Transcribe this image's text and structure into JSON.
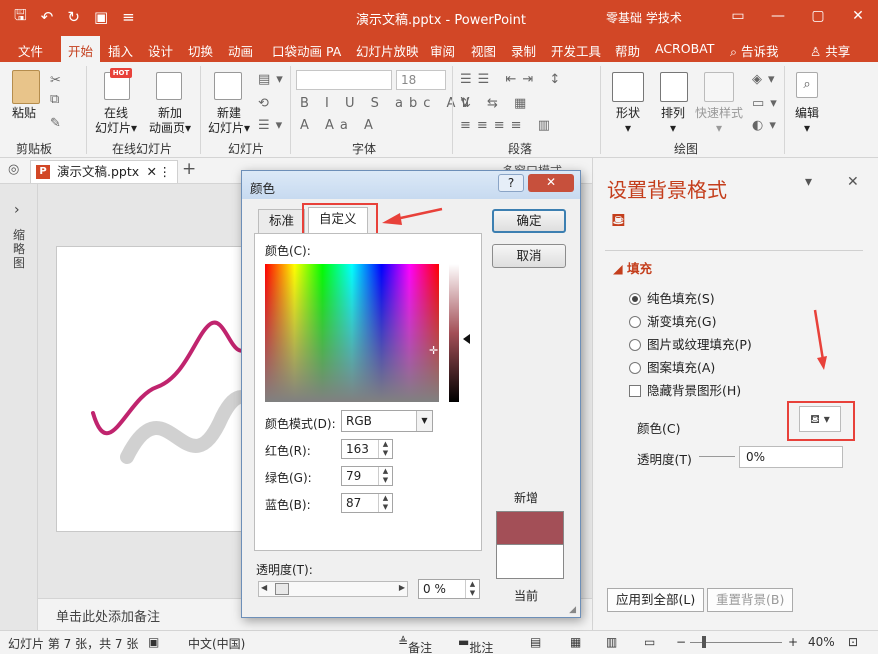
{
  "titlebar": {
    "title": "演示文稿.pptx  -  PowerPoint",
    "user": "零基础 学技术",
    "min": "—",
    "restore": "▢",
    "close": "✕"
  },
  "tabs": [
    "文件",
    "开始",
    "插入",
    "设计",
    "切换",
    "动画",
    "口袋动画 PA",
    "幻灯片放映",
    "审阅",
    "视图",
    "录制",
    "开发工具",
    "帮助",
    "ACROBAT",
    "告诉我",
    "共享"
  ],
  "ribbon": {
    "paste": "粘贴",
    "clipboard": "剪贴板",
    "online_slide": [
      "在线",
      "幻灯片"
    ],
    "new_anim": [
      "新加",
      "动画页"
    ],
    "online_group": "在线幻灯片",
    "new_slide": [
      "新建",
      "幻灯片"
    ],
    "slides_group": "幻灯片",
    "font_group": "字体",
    "para_group": "段落",
    "shape": "形状",
    "arrange": "排列",
    "quick_style": "快速样式",
    "drawing_group": "绘图",
    "edit": "编辑",
    "font_size": "18",
    "hot_badge": "HOT",
    "multiwin": "多窗口模式"
  },
  "doc": {
    "tab_name": "演示文稿.pptx",
    "ppt_letter": "P",
    "close": "✕",
    "more": "⋮",
    "add": "+",
    "left_label": "缩略图",
    "notes_placeholder": "单击此处添加备注"
  },
  "pane": {
    "title": "设置背景格式",
    "menu": "▾",
    "close": "✕",
    "section": "填充",
    "options": [
      "纯色填充(S)",
      "渐变填充(G)",
      "图片或纹理填充(P)",
      "图案填充(A)"
    ],
    "hide_bg": "隐藏背景图形(H)",
    "color_label": "颜色(C)",
    "transparency_label": "透明度(T)",
    "transparency_value": "0%",
    "apply_all": "应用到全部(L)",
    "reset_bg": "重置背景(B)"
  },
  "dialog": {
    "title": "颜色",
    "help": "?",
    "close": "✕",
    "tab_standard": "标准",
    "tab_custom": "自定义",
    "ok": "确定",
    "cancel": "取消",
    "colors_label": "颜色(C):",
    "mode_label": "颜色模式(D):",
    "mode_value": "RGB",
    "red_label": "红色(R):",
    "green_label": "绿色(G):",
    "blue_label": "蓝色(B):",
    "red": "163",
    "green": "79",
    "blue": "87",
    "new_label": "新增",
    "current_label": "当前",
    "transparency_label": "透明度(T):",
    "transparency_value": "0 %",
    "new_color": "#a34f57",
    "current_color": "#ffffff"
  },
  "status": {
    "slide_info": "幻灯片 第 7 张，共 7 张",
    "language": "中文(中国)",
    "notes": "备注",
    "comments": "批注",
    "zoom": "40%"
  },
  "colors": {
    "accent": "#d24726",
    "highlight": "#e8413a",
    "wave": "#c0246e"
  }
}
